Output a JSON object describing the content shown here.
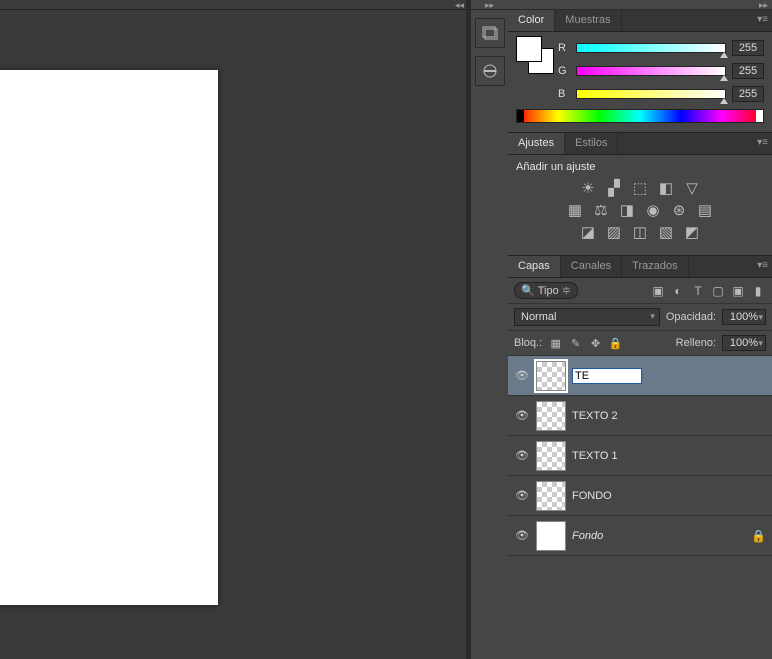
{
  "colorPanel": {
    "tabs": {
      "color": "Color",
      "swatches": "Muestras"
    },
    "channels": {
      "r": "R",
      "g": "G",
      "b": "B"
    },
    "values": {
      "r": "255",
      "g": "255",
      "b": "255"
    }
  },
  "adjustPanel": {
    "tabs": {
      "adjust": "Ajustes",
      "styles": "Estilos"
    },
    "addLabel": "Añadir un ajuste"
  },
  "layersPanel": {
    "tabs": {
      "layers": "Capas",
      "channels": "Canales",
      "paths": "Trazados"
    },
    "filterKind": "Tipo",
    "blendMode": "Normal",
    "opacityLabel": "Opacidad:",
    "opacityValue": "100%",
    "lockLabel": "Bloq.:",
    "fillLabel": "Relleno:",
    "fillValue": "100%",
    "layers": [
      {
        "name": "TE",
        "editing": true,
        "selected": true,
        "visible": true,
        "locked": false,
        "thumb": "checker"
      },
      {
        "name": "TEXTO 2",
        "editing": false,
        "selected": false,
        "visible": true,
        "locked": false,
        "thumb": "checker"
      },
      {
        "name": "TEXTO 1",
        "editing": false,
        "selected": false,
        "visible": true,
        "locked": false,
        "thumb": "checker"
      },
      {
        "name": "FONDO",
        "editing": false,
        "selected": false,
        "visible": true,
        "locked": false,
        "thumb": "checker"
      },
      {
        "name": "Fondo",
        "editing": false,
        "selected": false,
        "visible": true,
        "locked": true,
        "thumb": "white",
        "italic": true
      }
    ]
  }
}
